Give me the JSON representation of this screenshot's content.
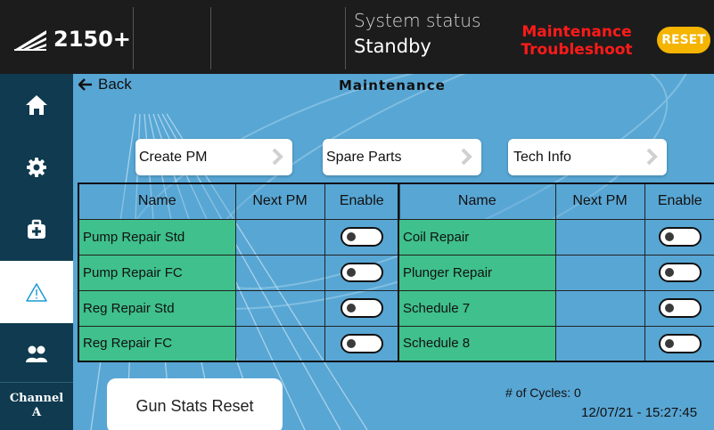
{
  "header": {
    "logo_text": "2150+",
    "system_status_label": "System status",
    "system_status_value": "Standby",
    "alert_line1": "Maintenance",
    "alert_line2": "Troubleshoot",
    "reset_label": "RESET",
    "alert_color": "#ff1a1a",
    "reset_color": "#f4b400"
  },
  "sidebar": {
    "items": [
      {
        "name": "home",
        "icon": "home-icon"
      },
      {
        "name": "settings",
        "icon": "gear-icon"
      },
      {
        "name": "maintenance",
        "icon": "toolbox-icon"
      },
      {
        "name": "alarms",
        "icon": "warning-icon",
        "active": true
      },
      {
        "name": "users",
        "icon": "users-icon"
      }
    ],
    "channel_label": "Channel",
    "channel_value": "A"
  },
  "main": {
    "back_label": "Back",
    "title": "Maintenance",
    "buttons": {
      "create_pm": "Create PM",
      "spare_parts": "Spare Parts",
      "tech_info": "Tech Info"
    },
    "table_headers": {
      "name": "Name",
      "next_pm": "Next PM",
      "enable": "Enable"
    },
    "left_rows": [
      {
        "name": "Pump Repair Std",
        "next_pm": "",
        "enabled": false
      },
      {
        "name": "Pump Repair FC",
        "next_pm": "",
        "enabled": false
      },
      {
        "name": "Reg Repair Std",
        "next_pm": "",
        "enabled": false
      },
      {
        "name": "Reg Repair FC",
        "next_pm": "",
        "enabled": false
      }
    ],
    "right_rows": [
      {
        "name": "Coil Repair",
        "next_pm": "",
        "enabled": false
      },
      {
        "name": "Plunger Repair",
        "next_pm": "",
        "enabled": false
      },
      {
        "name": "Schedule 7",
        "next_pm": "",
        "enabled": false
      },
      {
        "name": "Schedule 8",
        "next_pm": "",
        "enabled": false
      }
    ],
    "gun_stats_label": "Gun Stats Reset",
    "cycles_text": "# of Cycles: 0",
    "timestamp": "12/07/21 - 15:27:45"
  },
  "colors": {
    "main_bg": "#58a6d4",
    "sidebar_bg": "#0f3a4f",
    "row_name_bg": "#3fc08c"
  }
}
